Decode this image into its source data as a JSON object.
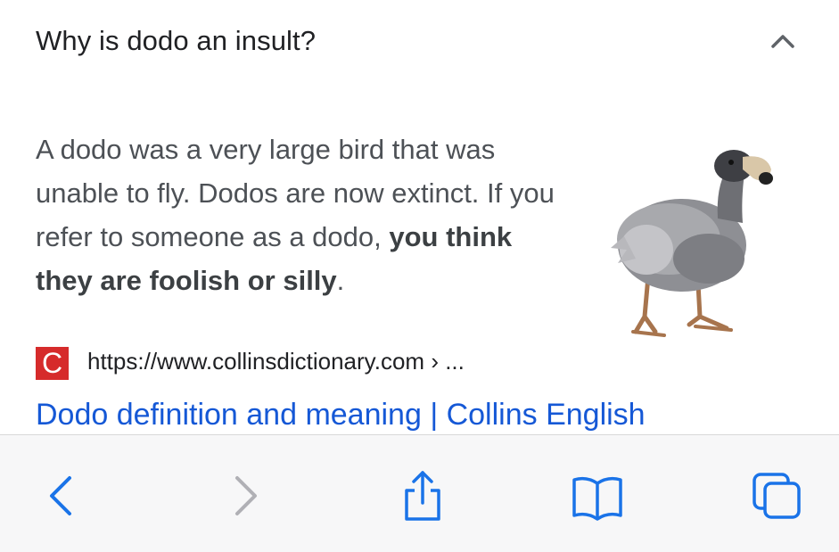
{
  "faq": {
    "question": "Why is dodo an insult?",
    "answer_plain": "A dodo was a very large bird that was unable to fly. Dodos are now extinct. If you refer to someone as a dodo, ",
    "answer_bold": "you think they are foolish or silly",
    "answer_end": ".",
    "image_alt": "dodo bird"
  },
  "source": {
    "favicon_letter": "C",
    "url": "https://www.collinsdictionary.com › ...",
    "title": "Dodo definition and meaning | Collins English"
  },
  "toolbar": {
    "back": "back-icon",
    "forward": "forward-icon",
    "share": "share-icon",
    "bookmarks": "bookmarks-icon",
    "tabs": "tabs-icon"
  },
  "colors": {
    "accent": "#1a73e8",
    "link": "#1558d6",
    "favicon": "#d62b2b",
    "disabled": "#b0b0b5"
  }
}
